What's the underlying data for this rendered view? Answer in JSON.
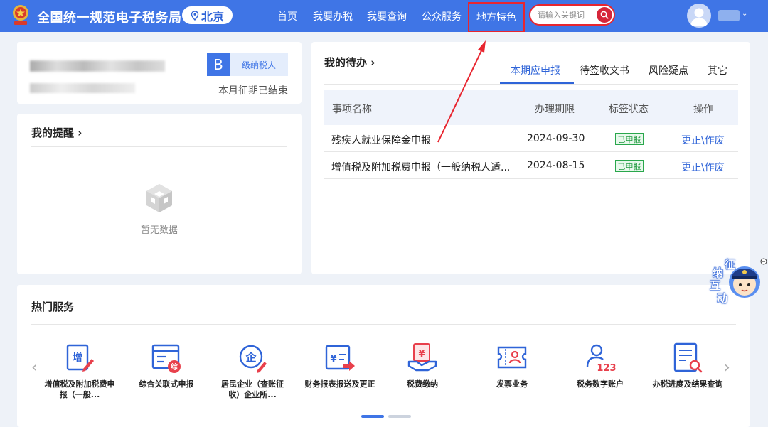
{
  "header": {
    "site_title": "全国统一规范电子税务局",
    "city": "北京",
    "nav": {
      "home": "首页",
      "tax": "我要办税",
      "query": "我要查询",
      "public": "公众服务",
      "local": "地方特色"
    },
    "search_placeholder": "请输入关键词",
    "accent_color": "#3f75e6",
    "highlight_color": "#e8252f"
  },
  "user_card": {
    "level_letter": "B",
    "level_text": "级纳税人",
    "period_status": "本月征期已结束"
  },
  "reminder": {
    "title": "我的提醒 ›",
    "empty_text": "暂无数据"
  },
  "todo": {
    "title": "我的待办 ›",
    "tabs": {
      "current": "本期应申报",
      "docs": "待签收文书",
      "risk": "风险疑点",
      "other": "其它"
    },
    "columns": {
      "name": "事项名称",
      "date": "办理期限",
      "status": "标签状态",
      "op": "操作"
    },
    "rows": [
      {
        "name": "残疾人就业保障金申报",
        "date": "2024-09-30",
        "status": "已申报",
        "op": "更正\\作废"
      },
      {
        "name": "增值税及附加税费申报（一般纳税人适...",
        "date": "2024-08-15",
        "status": "已申报",
        "op": "更正\\作废"
      }
    ]
  },
  "hot": {
    "title": "热门服务",
    "services": [
      {
        "label": "增值税及附加税费申报（一般...",
        "icon": "vat-declaration-icon"
      },
      {
        "label": "综合关联式申报",
        "icon": "integrated-declaration-icon"
      },
      {
        "label": "居民企业（查账征收）企业所...",
        "icon": "enterprise-income-icon"
      },
      {
        "label": "财务报表报送及更正",
        "icon": "financial-report-icon"
      },
      {
        "label": "税费缴纳",
        "icon": "tax-payment-icon"
      },
      {
        "label": "发票业务",
        "icon": "invoice-icon"
      },
      {
        "label": "税务数字账户",
        "icon": "digital-account-icon"
      },
      {
        "label": "办税进度及结果查询",
        "icon": "progress-query-icon"
      }
    ],
    "icon_texts": {
      "vat": "增",
      "integrated": "综",
      "enterprise": "企",
      "report": "¥",
      "payment": "¥",
      "account": "123"
    }
  },
  "widget": {
    "chars": [
      "征",
      "纳",
      "互",
      "动"
    ]
  }
}
